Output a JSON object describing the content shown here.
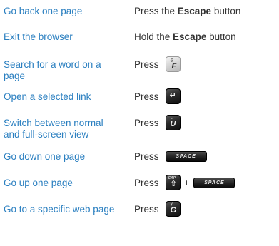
{
  "rows": [
    {
      "action": "Go back one page",
      "press": "Press the ",
      "bold": "Escape",
      "suffix": " button"
    },
    {
      "action": "Exit the browser",
      "press": "Hold the ",
      "bold": "Escape",
      "suffix": " button"
    },
    {
      "action": "Search for a word on a page",
      "press": "Press",
      "key": {
        "type": "light",
        "top_char": "6",
        "main_char": "F"
      }
    },
    {
      "action": "Open a selected link",
      "press": "Press",
      "key": {
        "type": "dark",
        "main_char": "↵"
      }
    },
    {
      "action": "Switch between normal and full-screen view",
      "press": "Press",
      "key": {
        "type": "dark",
        "top_char": "-",
        "main_char": "U"
      }
    },
    {
      "action": "Go down one page",
      "press": "Press",
      "key": {
        "type": "space",
        "label": "SPACE"
      }
    },
    {
      "action": "Go up one page",
      "press": "Press",
      "key": {
        "type": "dark",
        "top_char": "CAP",
        "main_char": "⇧"
      },
      "plus": "+",
      "key2": {
        "type": "space",
        "label": "SPACE"
      }
    },
    {
      "action": "Go to a specific web page",
      "press": "Press",
      "key": {
        "type": "dark",
        "top_char": "/",
        "main_char": "G"
      }
    }
  ]
}
